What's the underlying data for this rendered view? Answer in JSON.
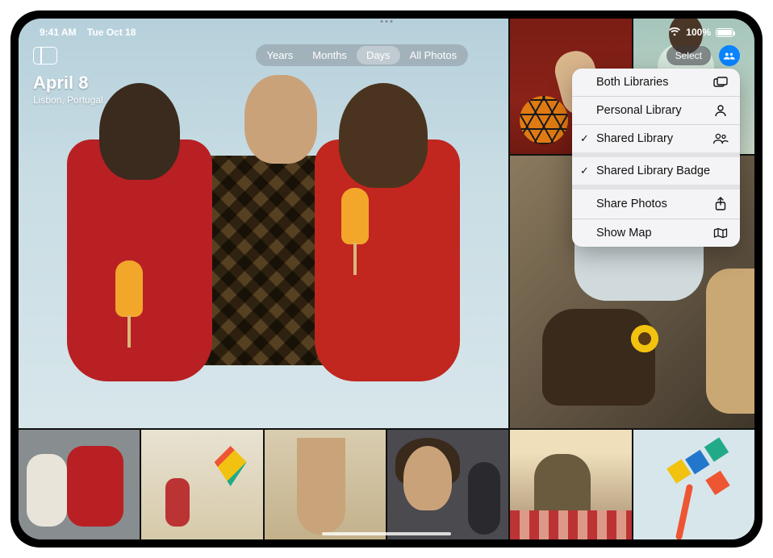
{
  "status": {
    "time": "9:41 AM",
    "date": "Tue Oct 18",
    "battery_pct": "100%"
  },
  "header": {
    "date_title": "April 8",
    "location": "Lisbon, Portugal",
    "segmented": {
      "years": "Years",
      "months": "Months",
      "days": "Days",
      "all": "All Photos",
      "active": "days"
    },
    "select_label": "Select"
  },
  "menu": {
    "both_libraries": "Both Libraries",
    "personal_library": "Personal Library",
    "shared_library": "Shared Library",
    "shared_library_badge": "Shared Library Badge",
    "share_photos": "Share Photos",
    "show_map": "Show Map",
    "checked": [
      "shared_library",
      "shared_library_badge"
    ]
  }
}
